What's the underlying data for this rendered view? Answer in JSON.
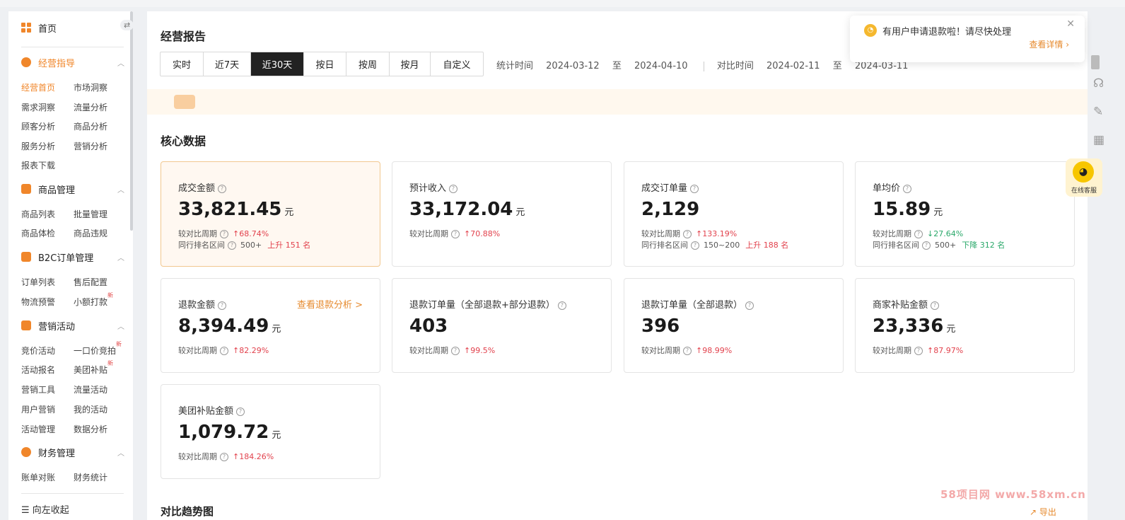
{
  "sidebar": {
    "home": "首页",
    "swap_icon": "⇄",
    "sections": [
      {
        "title": "经营指导",
        "items": [
          "经营首页",
          "市场洞察",
          "需求洞察",
          "流量分析",
          "顾客分析",
          "商品分析",
          "服务分析",
          "营销分析",
          "报表下载"
        ]
      },
      {
        "title": "商品管理",
        "items": [
          "商品列表",
          "批量管理",
          "商品体检",
          "商品违规"
        ]
      },
      {
        "title": "B2C订单管理",
        "items": [
          "订单列表",
          "售后配置",
          "物流预警",
          "小额打款"
        ]
      },
      {
        "title": "营销活动",
        "items": [
          "竞价活动",
          "一口价竞拍",
          "活动报名",
          "美团补贴",
          "营销工具",
          "流量活动",
          "用户营销",
          "我的活动",
          "活动管理",
          "数据分析"
        ]
      },
      {
        "title": "财务管理",
        "items": [
          "账单对账",
          "财务统计"
        ]
      }
    ],
    "new_tag": "新",
    "collapse": "向左收起"
  },
  "header": {
    "title": "经营报告",
    "tabs": [
      "实时",
      "近7天",
      "近30天",
      "按日",
      "按周",
      "按月",
      "自定义"
    ],
    "active_tab": 2,
    "stat_label": "统计时间",
    "stat_start": "2024-03-12",
    "stat_end": "2024-04-10",
    "to": "至",
    "compare_label": "对比时间",
    "compare_start": "2024-02-11",
    "compare_end": "2024-03-11"
  },
  "core": {
    "title": "核心数据",
    "compare_label": "较对比周期",
    "rank_label": "同行排名区间",
    "cards": [
      {
        "name": "成交金额",
        "value": "33,821.45",
        "unit": "元",
        "change": "68.74%",
        "dir": "up",
        "rank": "500+",
        "rank_change": "上升 151 名",
        "rank_dir": "up"
      },
      {
        "name": "预计收入",
        "value": "33,172.04",
        "unit": "元",
        "change": "70.88%",
        "dir": "up"
      },
      {
        "name": "成交订单量",
        "value": "2,129",
        "unit": "",
        "change": "133.19%",
        "dir": "up",
        "rank": "150~200",
        "rank_change": "上升 188 名",
        "rank_dir": "up"
      },
      {
        "name": "单均价",
        "value": "15.89",
        "unit": "元",
        "change": "27.64%",
        "dir": "down",
        "rank": "500+",
        "rank_change": "下降 312 名",
        "rank_dir": "down"
      },
      {
        "name": "退款金额",
        "value": "8,394.49",
        "unit": "元",
        "change": "82.29%",
        "dir": "up",
        "link": "查看退款分析 >"
      },
      {
        "name": "退款订单量（全部退款+部分退款）",
        "value": "403",
        "unit": "",
        "change": "99.5%",
        "dir": "up"
      },
      {
        "name": "退款订单量（全部退款）",
        "value": "396",
        "unit": "",
        "change": "98.99%",
        "dir": "up"
      },
      {
        "name": "商家补贴金额",
        "value": "23,336",
        "unit": "元",
        "change": "87.97%",
        "dir": "up"
      },
      {
        "name": "美团补贴金额",
        "value": "1,079.72",
        "unit": "元",
        "change": "184.26%",
        "dir": "up"
      }
    ]
  },
  "notification": {
    "text": "有用户申请退款啦！请尽快处理",
    "link": "查看详情 ›",
    "close": "✕"
  },
  "online_service": "在线客服",
  "trend_title": "对比趋势图",
  "export": "导出",
  "watermark": "58项目网 www.58xm.cn"
}
